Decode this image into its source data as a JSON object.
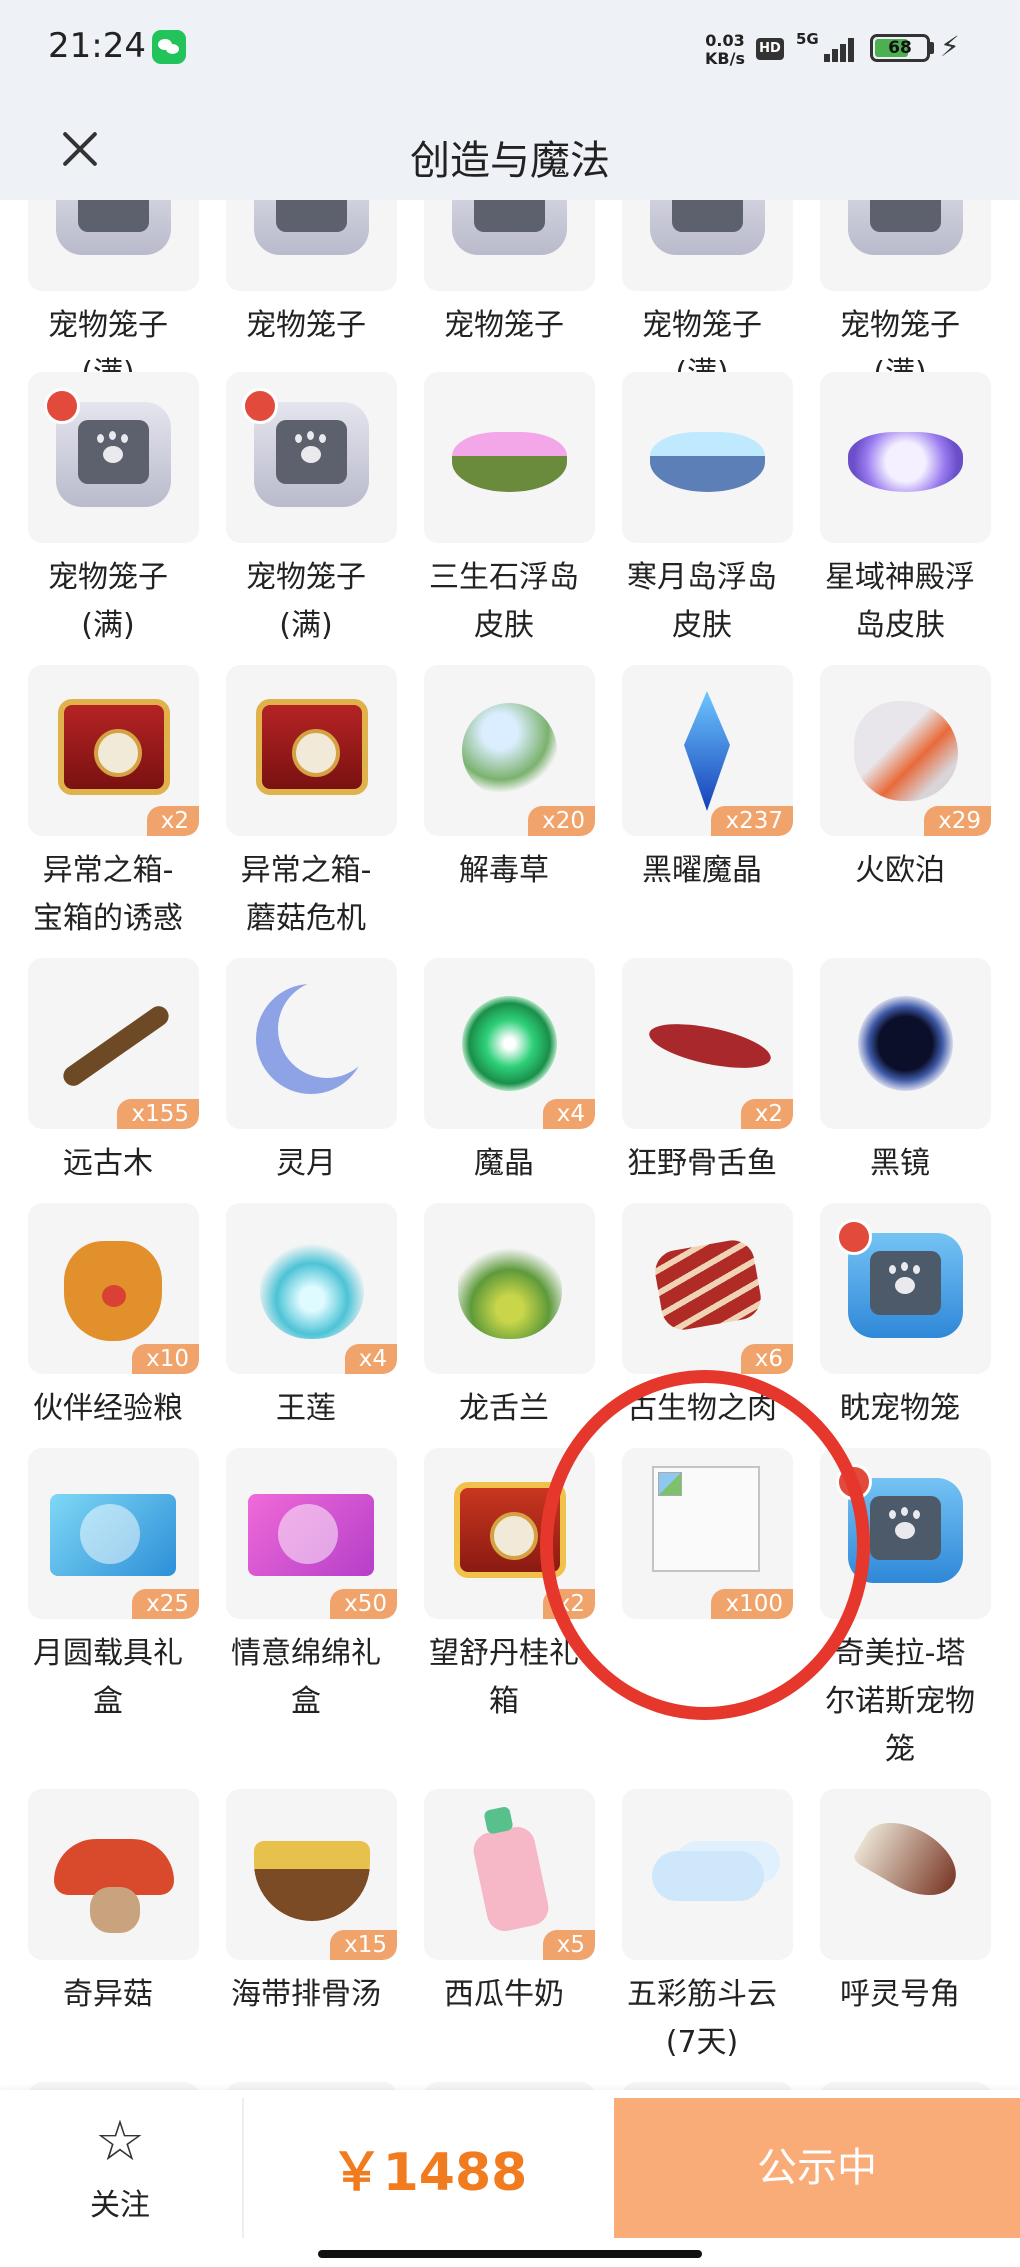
{
  "status_bar": {
    "time": "21:24",
    "net_speed_value": "0.03",
    "net_speed_unit": "KB/s",
    "hd": "HD",
    "network": "5G",
    "battery": "68"
  },
  "header": {
    "title": "创造与魔法"
  },
  "items": [
    {
      "name": "宠物笼子\n(满)",
      "qty": ""
    },
    {
      "name": "宠物笼子",
      "qty": ""
    },
    {
      "name": "宠物笼子",
      "qty": ""
    },
    {
      "name": "宠物笼子\n(满)",
      "qty": ""
    },
    {
      "name": "宠物笼子\n(满)",
      "qty": ""
    },
    {
      "name": "宠物笼子\n(满)",
      "qty": ""
    },
    {
      "name": "宠物笼子\n(满)",
      "qty": ""
    },
    {
      "name": "三生石浮岛\n皮肤",
      "qty": ""
    },
    {
      "name": "寒月岛浮岛\n皮肤",
      "qty": ""
    },
    {
      "name": "星域神殿浮\n岛皮肤",
      "qty": ""
    },
    {
      "name": "异常之箱-\n宝箱的诱惑",
      "qty": "x2"
    },
    {
      "name": "异常之箱-\n蘑菇危机",
      "qty": ""
    },
    {
      "name": "解毒草",
      "qty": "x20"
    },
    {
      "name": "黑曜魔晶",
      "qty": "x237"
    },
    {
      "name": "火欧泊",
      "qty": "x29"
    },
    {
      "name": "远古木",
      "qty": "x155"
    },
    {
      "name": "灵月",
      "qty": ""
    },
    {
      "name": "魔晶",
      "qty": "x4"
    },
    {
      "name": "狂野骨舌鱼",
      "qty": "x2"
    },
    {
      "name": "黑镜",
      "qty": ""
    },
    {
      "name": "伙伴经验粮",
      "qty": "x10"
    },
    {
      "name": "王莲",
      "qty": "x4"
    },
    {
      "name": "龙舌兰",
      "qty": ""
    },
    {
      "name": "古生物之肉",
      "qty": "x6"
    },
    {
      "name": "眈宠物笼",
      "qty": ""
    },
    {
      "name": "月圆载具礼\n盒",
      "qty": "x25"
    },
    {
      "name": "情意绵绵礼\n盒",
      "qty": "x50"
    },
    {
      "name": "望舒丹桂礼\n箱",
      "qty": "x2"
    },
    {
      "name": "",
      "qty": "x100"
    },
    {
      "name": "奇美拉-塔\n尔诺斯宠物\n笼",
      "qty": ""
    },
    {
      "name": "奇异菇",
      "qty": ""
    },
    {
      "name": "海带排骨汤",
      "qty": "x15"
    },
    {
      "name": "西瓜牛奶",
      "qty": "x5"
    },
    {
      "name": "五彩筋斗云\n(7天)",
      "qty": ""
    },
    {
      "name": "呼灵号角",
      "qty": ""
    }
  ],
  "bottom_bar": {
    "follow_label": "关注",
    "price": "￥1488",
    "status_label": "公示中"
  },
  "icons": [
    "close-icon",
    "star-icon",
    "wechat-icon",
    "battery-icon",
    "signal-icon"
  ],
  "colors": {
    "accent": "#f17b1f",
    "status_button": "#f9ac78",
    "annotation": "#e5372b",
    "qty_badge": "#f0a36b"
  }
}
